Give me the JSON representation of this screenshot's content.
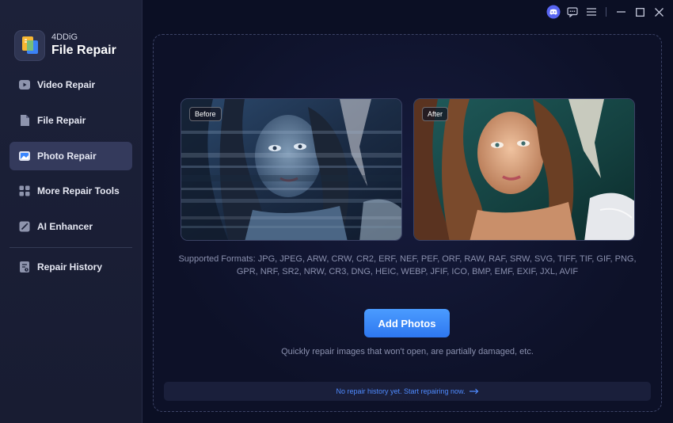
{
  "app": {
    "brand_small": "4DDiG",
    "brand_big": "File Repair"
  },
  "sidebar": {
    "items": [
      {
        "label": "Video Repair",
        "icon": "video-icon",
        "active": false
      },
      {
        "label": "File Repair",
        "icon": "file-icon",
        "active": false
      },
      {
        "label": "Photo Repair",
        "icon": "photo-icon",
        "active": true
      },
      {
        "label": "More Repair Tools",
        "icon": "grid-icon",
        "active": false
      },
      {
        "label": "AI Enhancer",
        "icon": "magic-wand-icon",
        "active": false
      }
    ],
    "history": {
      "label": "Repair History",
      "icon": "history-icon"
    }
  },
  "titlebar": {
    "icons": [
      "discord-icon",
      "feedback-icon",
      "menu-icon",
      "minimize-icon",
      "maximize-icon",
      "close-icon"
    ]
  },
  "main": {
    "before_label": "Before",
    "after_label": "After",
    "formats_line1": "Supported Formats: JPG, JPEG, ARW, CRW, CR2, ERF, NEF, PEF, ORF, RAW, RAF, SRW, SVG, TIFF, TIF, GIF, PNG,",
    "formats_line2": "GPR, NRF, SR2, NRW, CR3, DNG, HEIC, WEBP, JFIF, ICO, BMP, EMF, EXIF, JXL, AVIF",
    "add_button": "Add Photos",
    "add_subtitle": "Quickly repair images that won't open, are partially damaged, etc.",
    "history_text": "No repair history yet. Start repairing now."
  },
  "colors": {
    "accent": "#3a86ff",
    "background": "#0b0f24",
    "sidebar": "#1c2139",
    "active_item": "#343a5c",
    "link": "#4f8bff"
  }
}
